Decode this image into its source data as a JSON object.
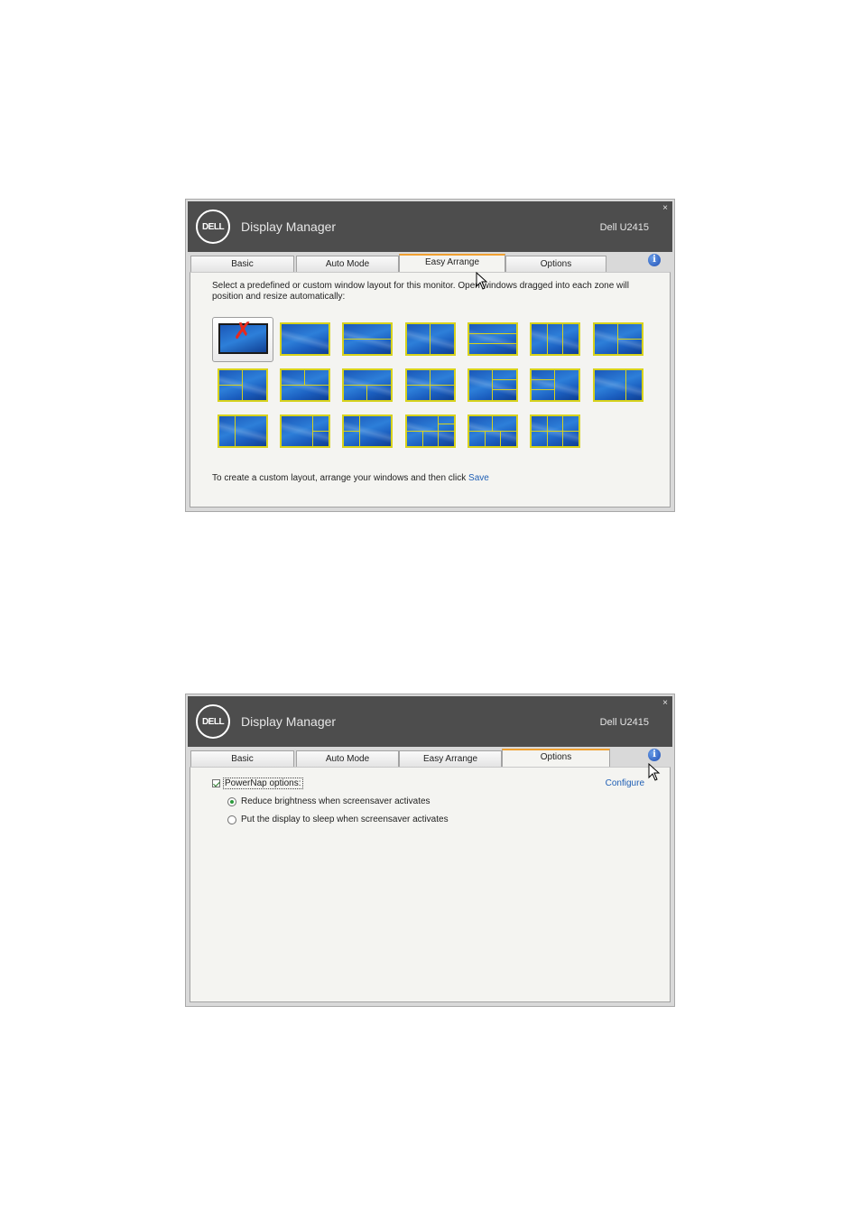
{
  "window1": {
    "app_title": "Display Manager",
    "logo_text": "DELL",
    "monitor": "Dell U2415",
    "close": "×",
    "tabs": [
      {
        "label": "Basic",
        "active": false
      },
      {
        "label": "Auto Mode",
        "active": false
      },
      {
        "label": "Easy Arrange",
        "active": true
      },
      {
        "label": "Options",
        "active": false
      }
    ],
    "info_icon": "i",
    "description": "Select a predefined or custom window layout for this monitor.  Open windows dragged into each zone will position and resize automatically:",
    "layouts": [
      "none",
      "full",
      "two-horizontal",
      "two-vertical",
      "three-horizontal",
      "three-vertical",
      "left-plus-two-right",
      "right-plus-two-left",
      "top-plus-two-bottom",
      "bottom-plus-two-top",
      "four-grid",
      "left-plus-three-right",
      "right-plus-three-left",
      "two-vertical-narrow-right",
      "two-vertical-wide",
      "right-plus-two-left-alt",
      "left-wide-plus-two-right",
      "two-top-plus-three-bottom",
      "three-top-plus-two-bottom",
      "six-grid"
    ],
    "footer_text": "To create a custom layout, arrange your windows and then click ",
    "footer_link": "Save"
  },
  "window2": {
    "app_title": "Display Manager",
    "logo_text": "DELL",
    "monitor": "Dell U2415",
    "close": "×",
    "tabs": [
      {
        "label": "Basic",
        "active": false
      },
      {
        "label": "Auto Mode",
        "active": false
      },
      {
        "label": "Easy Arrange",
        "active": false
      },
      {
        "label": "Options",
        "active": true
      }
    ],
    "info_icon": "i",
    "powernap_label": "PowerNap options:",
    "powernap_checked": true,
    "configure_link": "Configure",
    "radio_options": [
      {
        "label": "Reduce brightness when screensaver activates",
        "selected": true
      },
      {
        "label": "Put the display to sleep when screensaver activates",
        "selected": false
      }
    ]
  }
}
